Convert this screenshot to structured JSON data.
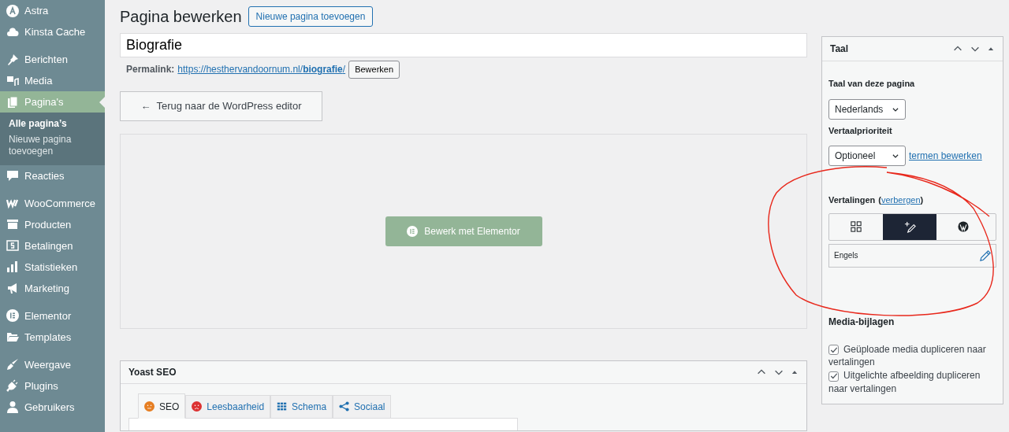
{
  "sidebar": {
    "groups": [
      {
        "items": [
          {
            "label": "Astra",
            "selected": false
          },
          {
            "label": "Kinsta Cache",
            "selected": false
          }
        ]
      },
      {
        "items": [
          {
            "label": "Berichten",
            "selected": false
          },
          {
            "label": "Media",
            "selected": false
          },
          {
            "label": "Pagina's",
            "selected": true,
            "children": [
              {
                "label": "Alle pagina’s",
                "selected": true
              },
              {
                "label": "Nieuwe pagina toevoegen",
                "selected": false
              }
            ]
          },
          {
            "label": "Reacties",
            "selected": false
          }
        ]
      },
      {
        "items": [
          {
            "label": "WooCommerce",
            "selected": false
          },
          {
            "label": "Producten",
            "selected": false
          },
          {
            "label": "Betalingen",
            "selected": false
          },
          {
            "label": "Statistieken",
            "selected": false
          },
          {
            "label": "Marketing",
            "selected": false
          }
        ]
      },
      {
        "items": [
          {
            "label": "Elementor",
            "selected": false
          },
          {
            "label": "Templates",
            "selected": false
          }
        ]
      },
      {
        "items": [
          {
            "label": "Weergave",
            "selected": false
          },
          {
            "label": "Plugins",
            "selected": false
          },
          {
            "label": "Gebruikers",
            "selected": false
          }
        ]
      }
    ]
  },
  "header": {
    "title": "Pagina bewerken",
    "add_button": "Nieuwe pagina toevoegen"
  },
  "title_field": {
    "value": "Biografie"
  },
  "permalink": {
    "label": "Permalink:",
    "url_start": "https://hesthervandoornum.nl/",
    "url_slug": "biografie",
    "url_end": "/",
    "edit_button": "Bewerken"
  },
  "back_button": {
    "icon": "←",
    "label": "Terug naar de WordPress editor"
  },
  "elementor_button": "Bewerk met Elementor",
  "yoast": {
    "title": "Yoast SEO",
    "tabs": [
      {
        "label": "SEO",
        "kind": "face",
        "color": "#e67e22",
        "selected": true
      },
      {
        "label": "Leesbaarheid",
        "kind": "sad",
        "color": "#dc3232",
        "selected": false
      },
      {
        "label": "Schema",
        "kind": "grid",
        "selected": false
      },
      {
        "label": "Sociaal",
        "kind": "share",
        "selected": false
      }
    ]
  },
  "language_box": {
    "title": "Taal",
    "page_language_label": "Taal van deze pagina",
    "page_language": "Nederlands",
    "priority_label": "Vertaalprioriteit",
    "priority": "Optioneel",
    "terms_link": "termen bewerken",
    "translations_label": "Vertalingen",
    "hide_link_open": "(",
    "hide_link": "verbergen",
    "hide_link_close": ")",
    "translation_tools": [
      {
        "kind": "grid",
        "selected": false
      },
      {
        "kind": "add",
        "selected": true
      },
      {
        "kind": "wordpress",
        "selected": false
      }
    ],
    "translations": [
      {
        "language": "Engels"
      }
    ],
    "media_title": "Media-bijlagen",
    "options": [
      {
        "label": "Geüploade media dupliceren naar vertalingen",
        "checked": true
      },
      {
        "label": "Uitgelichte afbeelding dupliceren naar vertalingen",
        "checked": true
      }
    ]
  }
}
